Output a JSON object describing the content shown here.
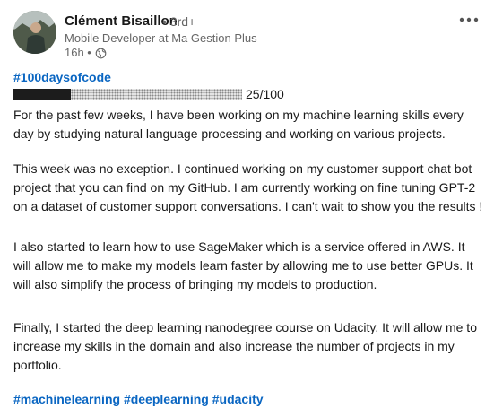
{
  "author": {
    "name": "Clément Bisaillon",
    "degree": "• 3rd+",
    "headline": "Mobile Developer at Ma Gestion Plus",
    "time": "16h •"
  },
  "icons": {
    "visibility": "globe-icon",
    "menu": "more-horizontal-icon"
  },
  "post": {
    "top_hashtag": "#100daysofcode",
    "progress": {
      "value": 0.25,
      "label": "25/100"
    },
    "paragraphs": [
      "For the past few weeks, I have been working on my machine learning skills every day by studying natural language processing and working on various projects.",
      "This week was no exception. I continued working on my customer support chat bot project that you can find on my GitHub. I am currently working on fine tuning GPT-2 on a dataset of customer support conversations. I can't wait to show you the results !",
      "I also started to learn how to use SageMaker which is a service offered in AWS. It will allow me to make my models learn faster by allowing me to use better GPUs. It will also simplify the process of bringing my models to production.",
      "Finally, I started the deep learning nanodegree course on Udacity. It will allow me to increase my skills in the domain and also increase the number of projects in my portfolio."
    ],
    "hashtags": [
      "#machinelearning",
      "#deeplearning",
      "#udacity"
    ]
  },
  "colors": {
    "link": "#0a66c2",
    "text": "#191919",
    "meta": "#666666"
  }
}
